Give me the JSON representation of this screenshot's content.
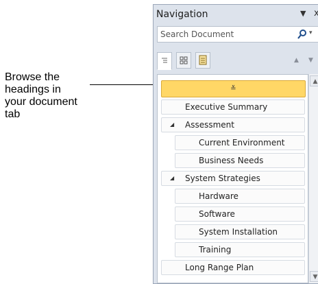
{
  "callout": {
    "lines": [
      "Browse the",
      "headings in",
      "your document",
      "tab"
    ]
  },
  "pane": {
    "title": "Navigation",
    "menu_glyph": "▼",
    "close_glyph": "x",
    "search": {
      "placeholder": "Search Document",
      "dropdown_glyph": "▾"
    },
    "tabs": [
      {
        "name": "tab-browse-headings",
        "active": true
      },
      {
        "name": "tab-browse-pages",
        "active": false
      },
      {
        "name": "tab-browse-results",
        "active": false
      }
    ],
    "nav": {
      "previous_glyph": "▲",
      "next_glyph": "▼"
    },
    "selected_item_glyph": "≚",
    "headings": [
      {
        "label": "Executive Summary",
        "level": 1,
        "expanded": false
      },
      {
        "label": "Assessment",
        "level": 1,
        "expanded": true,
        "toggle_glyph": "◢"
      },
      {
        "label": "Current Environment",
        "level": 2
      },
      {
        "label": "Business Needs",
        "level": 2
      },
      {
        "label": "System Strategies",
        "level": 1,
        "expanded": true,
        "toggle_glyph": "◢"
      },
      {
        "label": "Hardware",
        "level": 2
      },
      {
        "label": "Software",
        "level": 2
      },
      {
        "label": "System Installation",
        "level": 2
      },
      {
        "label": "Training",
        "level": 2
      },
      {
        "label": "Long Range Plan",
        "level": 1,
        "expanded": false
      }
    ],
    "scrollbar": {
      "up_glyph": "▲",
      "down_glyph": "▼"
    },
    "colors": {
      "selected": "#ffd766",
      "pane_bg": "#dde3ec"
    }
  }
}
